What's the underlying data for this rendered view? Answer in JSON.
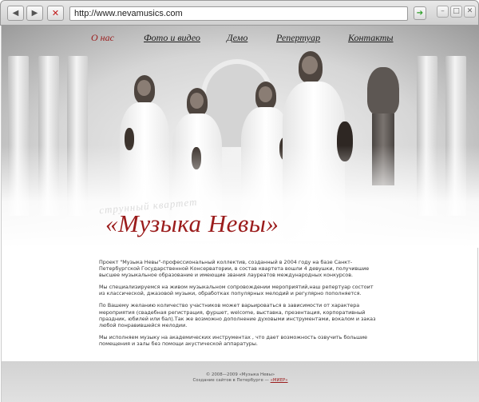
{
  "browser": {
    "back_icon": "◀",
    "forward_icon": "▶",
    "stop_icon": "✕",
    "url": "http://www.nevamusics.com",
    "go_icon": "➔",
    "minimize_icon": "–",
    "maximize_icon": "□",
    "close_icon": "✕"
  },
  "nav": {
    "items": [
      {
        "label": "О нас"
      },
      {
        "label": "Фото и видео"
      },
      {
        "label": "Демо"
      },
      {
        "label": "Репертуар"
      },
      {
        "label": "Контакты"
      }
    ]
  },
  "hero": {
    "subtitle": "струнный квартет",
    "title": "«Музыка Невы»"
  },
  "content": {
    "paragraphs": [
      "Проект \"Музыка Невы\"-профессиональный коллектив, созданный в 2004 году на базе Санкт-Петербургской Государственной Консерватории, в состав квартета вошли 4 девушки, получившие высшее музыкальное образование и имеющие звания лауреатов международных конкурсов.",
      "Мы специализируемся на живом музыкальном сопровождении мероприятий,наш репертуар состоит из классической, джазовой музыки, обработках популярных мелодий и регулярно пополняется.",
      "По Вашему желанию количество участников может варьироваться в зависимости от характера мероприятия (свадебная регистрация, фуршет, welcome, выставка, презентация, корпоративный праздник, юбилей или бал).Так же возможно дополнение духовыми инструментами, вокалом и  заказ любой понравившейся мелодии.",
      "Мы исполняем музыку на академических инструментах , что дает возможность озвучить большие помещения и залы без помощи акустической аппаратуры."
    ]
  },
  "footer": {
    "copyright": "© 2008—2009 «Музыка Невы»",
    "credits_prefix": "Создание сайтов в Петербурге —",
    "credits_link": "«МИЕР»"
  },
  "colors": {
    "accent": "#9b1c1c",
    "footer_bg": "#d9d9d9"
  }
}
